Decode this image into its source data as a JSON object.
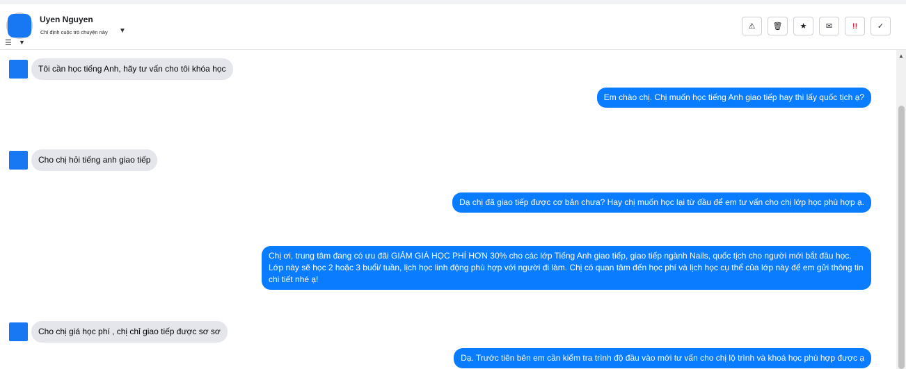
{
  "header": {
    "name": "Uyen Nguyen",
    "assign_label": "Chỉ định cuộc trò chuyện này",
    "actions": [
      {
        "icon": "warning-icon",
        "glyph": "⚠"
      },
      {
        "icon": "trash-icon",
        "glyph": "🗑"
      },
      {
        "icon": "star-icon",
        "glyph": "★"
      },
      {
        "icon": "mail-icon",
        "glyph": "✉"
      },
      {
        "icon": "spam-icon",
        "glyph": "!!"
      },
      {
        "icon": "check-icon",
        "glyph": "✓"
      }
    ]
  },
  "messages": [
    {
      "direction": "in",
      "text": "Tôi cần học tiếng Anh, hãy tư vấn cho tôi khóa học"
    },
    {
      "direction": "out",
      "text": "Em chào chị. Chị muốn học tiếng Anh giao tiếp hay thi lấy quốc tịch ạ?"
    },
    {
      "direction": "in",
      "text": "Cho chị hỏi tiếng anh giao tiếp"
    },
    {
      "direction": "out",
      "text": "Dạ chị đã giao tiếp được cơ bản chưa? Hay chị muốn học lại từ đầu để em tư vấn cho chị lớp học phù hợp ạ."
    },
    {
      "direction": "out",
      "text": "Chị ơi, trung tâm đang có ưu đãi GIẢM GIÁ HỌC PHÍ HƠN 30% cho các lớp Tiếng Anh giao tiếp, giao tiếp ngành Nails, quốc tịch cho người mới bắt đầu học. Lớp này sẽ học 2 hoặc 3 buổi/ tuần, lịch học linh động phù hợp với người đi làm. Chị có quan tâm đến học phí và lịch học cụ thể của lớp này để em gửi thông tin chi tiết nhé ạ!"
    },
    {
      "direction": "in",
      "text": "Cho chị giá học phí , chị chỉ giao tiếp được sơ sơ"
    },
    {
      "direction": "out",
      "text": "Dạ. Trước tiên bên em cần kiểm tra trình độ đầu vào mới tư vấn cho chị lộ trình và khoá học phù hợp được ạ"
    }
  ]
}
